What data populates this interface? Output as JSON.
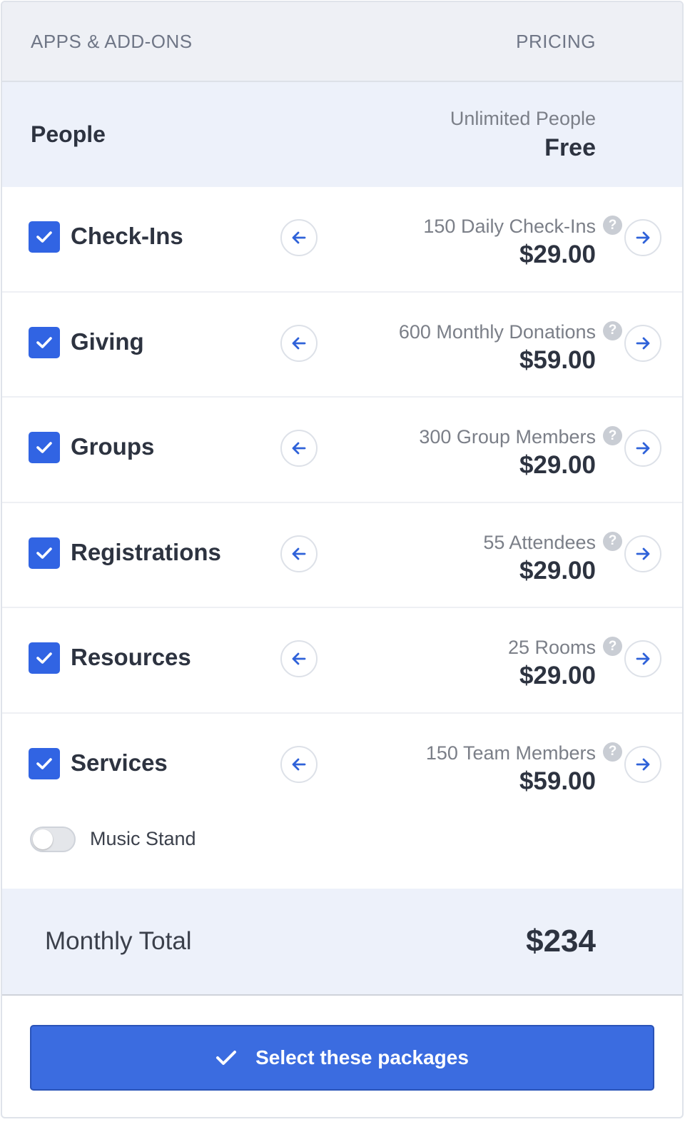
{
  "header": {
    "apps_label": "APPS & ADD-ONS",
    "pricing_label": "PRICING"
  },
  "people": {
    "name": "People",
    "sub": "Unlimited People",
    "price": "Free"
  },
  "items": [
    {
      "name": "Check-Ins",
      "label": "150 Daily Check-Ins",
      "price": "$29.00",
      "checked": true
    },
    {
      "name": "Giving",
      "label": "600 Monthly Donations",
      "price": "$59.00",
      "checked": true
    },
    {
      "name": "Groups",
      "label": "300 Group Members",
      "price": "$29.00",
      "checked": true
    },
    {
      "name": "Registrations",
      "label": "55 Attendees",
      "price": "$29.00",
      "checked": true
    },
    {
      "name": "Resources",
      "label": "25 Rooms",
      "price": "$29.00",
      "checked": true
    },
    {
      "name": "Services",
      "label": "150 Team Members",
      "price": "$59.00",
      "checked": true
    }
  ],
  "addon": {
    "label": "Music Stand",
    "enabled": false
  },
  "total": {
    "label": "Monthly Total",
    "value": "$234"
  },
  "cta": {
    "label": "Select these packages"
  },
  "icons": {
    "check": "checkmark-icon",
    "prev": "arrow-left-icon",
    "next": "arrow-right-icon",
    "help": "question-icon",
    "help_glyph": "?"
  },
  "colors": {
    "accent": "#3164e3",
    "button": "#3b6ce0",
    "header_bg": "#eef0f5",
    "highlight_bg": "#edf1fa"
  }
}
